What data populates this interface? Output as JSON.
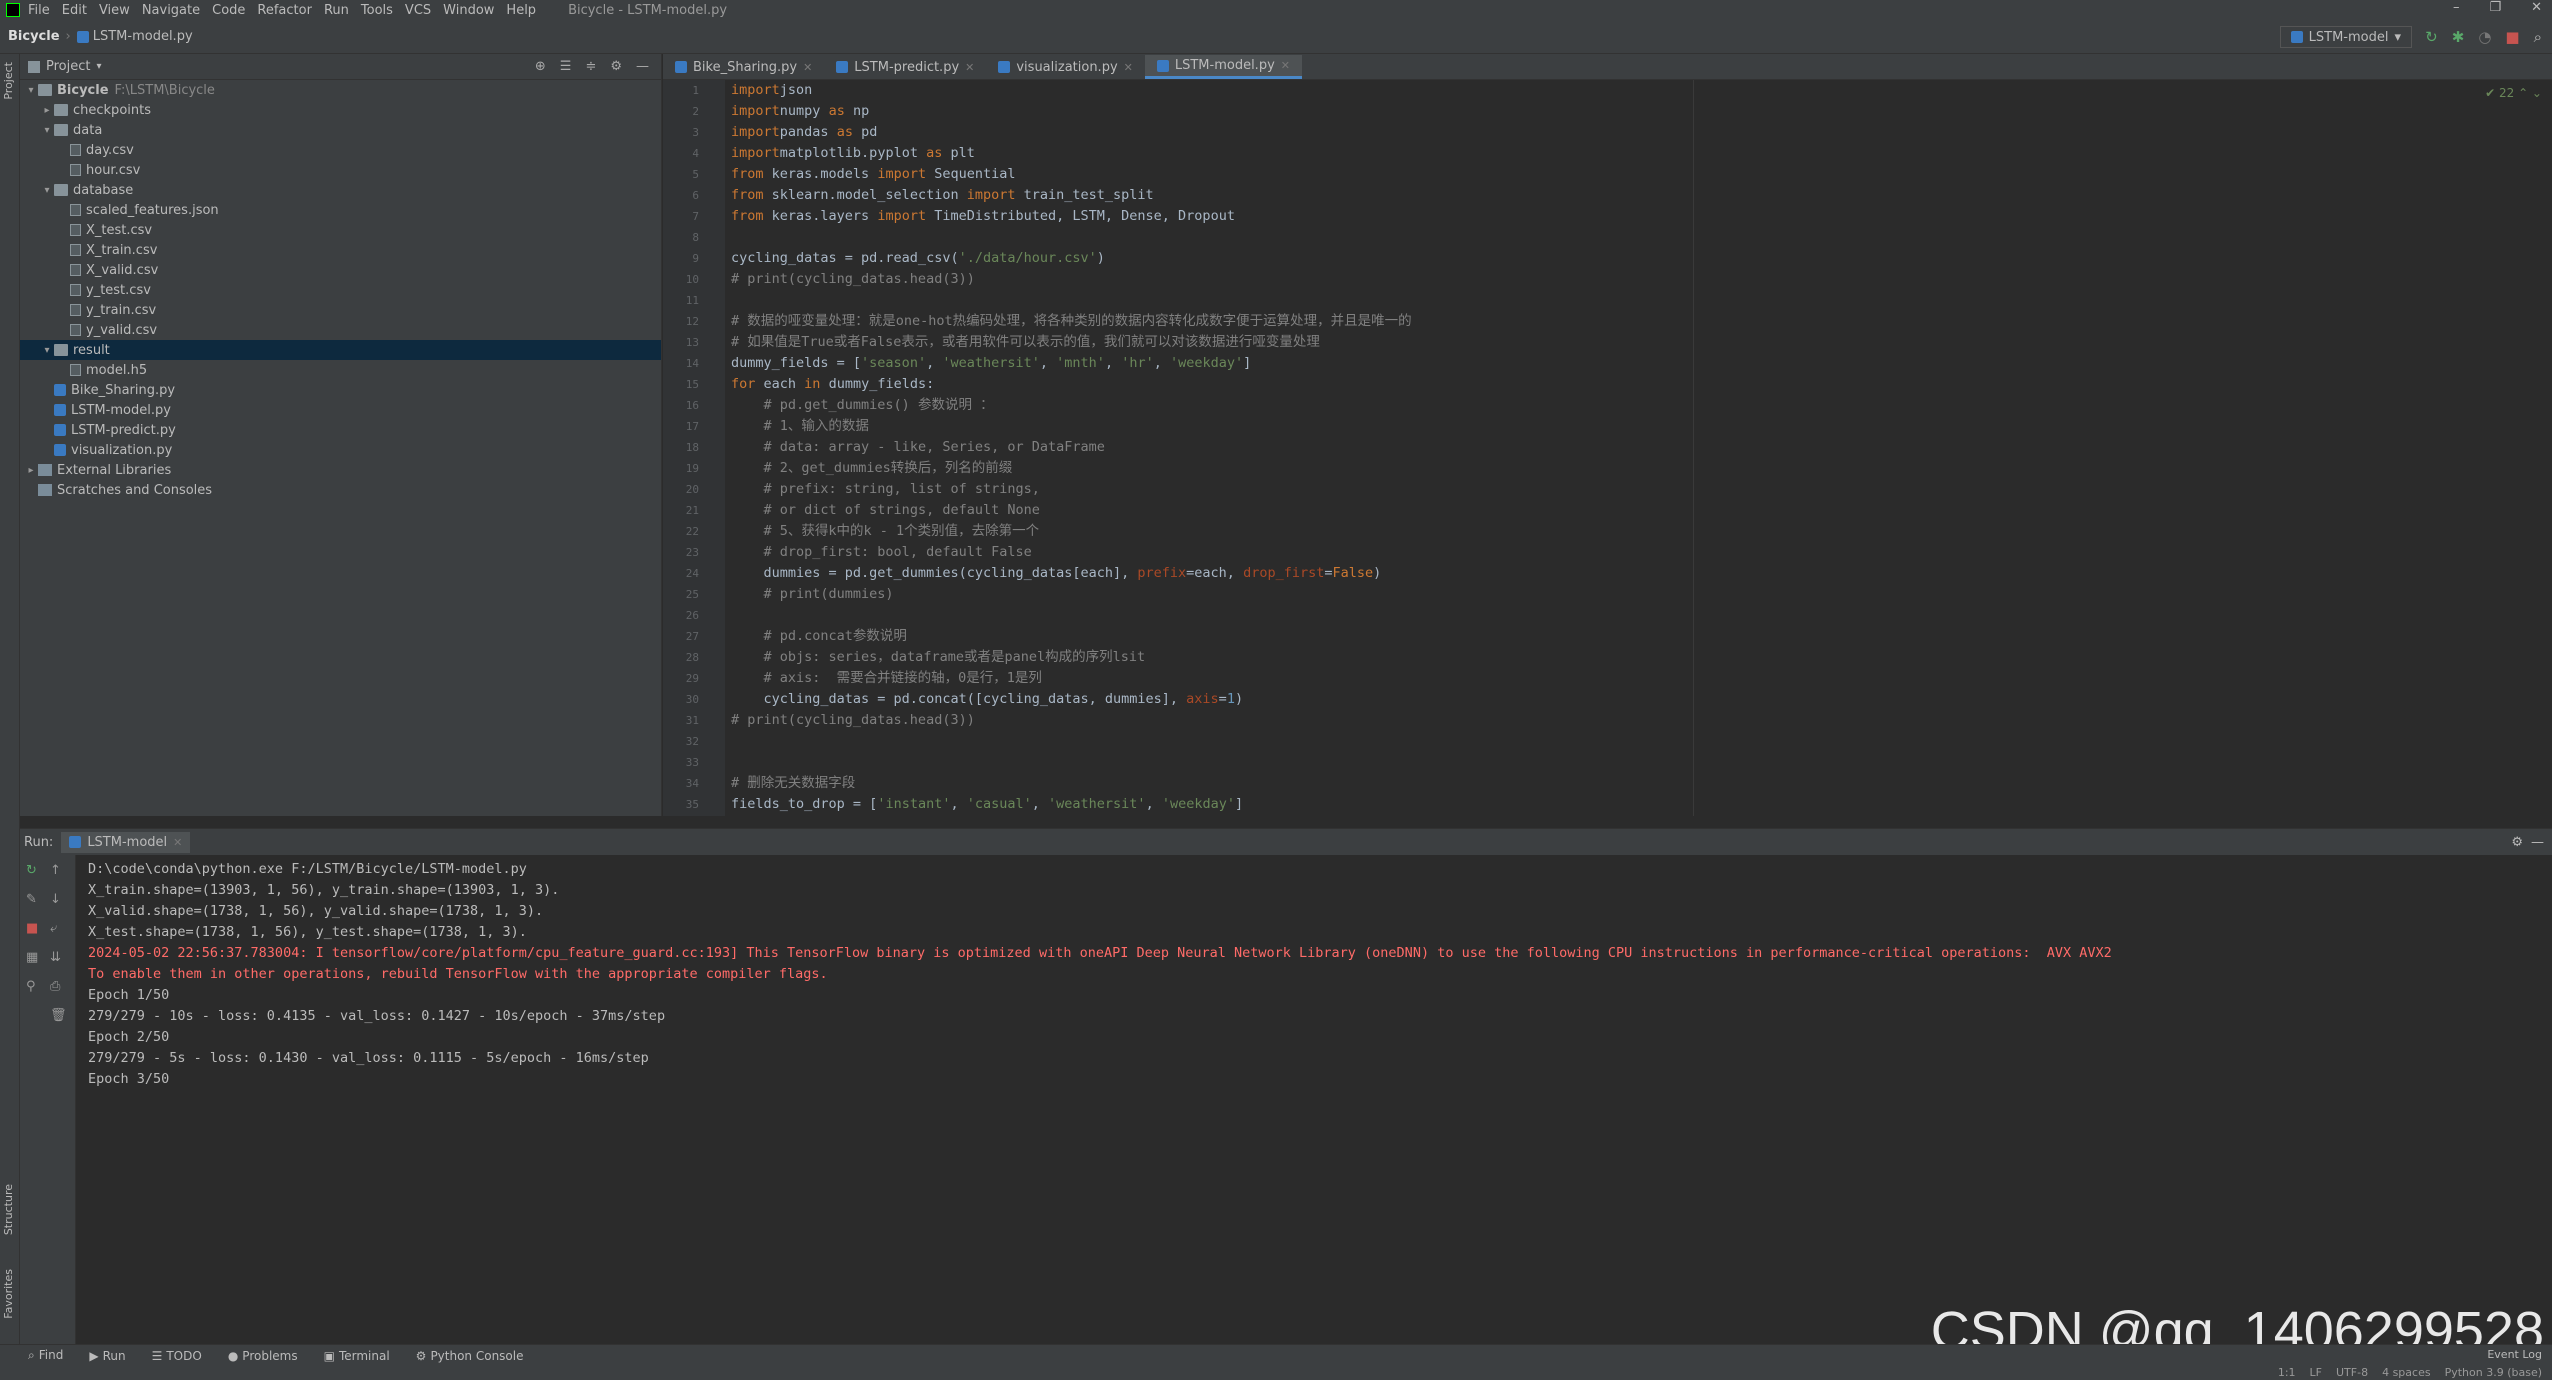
{
  "menubar": {
    "items": [
      "File",
      "Edit",
      "View",
      "Navigate",
      "Code",
      "Refactor",
      "Run",
      "Tools",
      "VCS",
      "Window",
      "Help"
    ],
    "window_title": "Bicycle - LSTM-model.py"
  },
  "navbar": {
    "project": "Bicycle",
    "file": "LSTM-model.py",
    "run_config": "LSTM-model"
  },
  "project_panel": {
    "title": "Project",
    "tree": [
      {
        "label": "Bicycle",
        "path": "F:\\LSTM\\Bicycle",
        "level": 0,
        "type": "folder",
        "open": true
      },
      {
        "label": "checkpoints",
        "level": 1,
        "type": "folder",
        "open": false
      },
      {
        "label": "data",
        "level": 1,
        "type": "folder",
        "open": true
      },
      {
        "label": "day.csv",
        "level": 2,
        "type": "file"
      },
      {
        "label": "hour.csv",
        "level": 2,
        "type": "file"
      },
      {
        "label": "database",
        "level": 1,
        "type": "folder",
        "open": true
      },
      {
        "label": "scaled_features.json",
        "level": 2,
        "type": "file"
      },
      {
        "label": "X_test.csv",
        "level": 2,
        "type": "file"
      },
      {
        "label": "X_train.csv",
        "level": 2,
        "type": "file"
      },
      {
        "label": "X_valid.csv",
        "level": 2,
        "type": "file"
      },
      {
        "label": "y_test.csv",
        "level": 2,
        "type": "file"
      },
      {
        "label": "y_train.csv",
        "level": 2,
        "type": "file"
      },
      {
        "label": "y_valid.csv",
        "level": 2,
        "type": "file"
      },
      {
        "label": "result",
        "level": 1,
        "type": "folder",
        "open": true,
        "selected": true
      },
      {
        "label": "model.h5",
        "level": 2,
        "type": "file"
      },
      {
        "label": "Bike_Sharing.py",
        "level": 1,
        "type": "py"
      },
      {
        "label": "LSTM-model.py",
        "level": 1,
        "type": "py"
      },
      {
        "label": "LSTM-predict.py",
        "level": 1,
        "type": "py"
      },
      {
        "label": "visualization.py",
        "level": 1,
        "type": "py"
      },
      {
        "label": "External Libraries",
        "level": 0,
        "type": "lib",
        "open": false
      },
      {
        "label": "Scratches and Consoles",
        "level": 0,
        "type": "lib"
      }
    ]
  },
  "editor": {
    "tabs": [
      "Bike_Sharing.py",
      "LSTM-predict.py",
      "visualization.py",
      "LSTM-model.py"
    ],
    "active_tab": 3,
    "inspection_count": "22",
    "line_numbers": [
      "1",
      "2",
      "3",
      "4",
      "5",
      "6",
      "7",
      "8",
      "9",
      "10",
      "11",
      "12",
      "13",
      "14",
      "15",
      "16",
      "17",
      "18",
      "19",
      "20",
      "21",
      "22",
      "23",
      "24",
      "25",
      "26",
      "27",
      "28",
      "29",
      "30",
      "31",
      "32",
      "33",
      "34",
      "35"
    ],
    "lines": [
      [
        [
          "kw",
          "import"
        ],
        [
          "",
          "json"
        ]
      ],
      [
        [
          "kw",
          "import"
        ],
        [
          "",
          "numpy "
        ],
        [
          "kw",
          "as"
        ],
        [
          "",
          " np"
        ]
      ],
      [
        [
          "kw",
          "import"
        ],
        [
          "",
          "pandas "
        ],
        [
          "kw",
          "as"
        ],
        [
          "",
          " pd"
        ]
      ],
      [
        [
          "kw",
          "import"
        ],
        [
          "",
          "matplotlib.pyplot "
        ],
        [
          "kw",
          "as"
        ],
        [
          "",
          " plt"
        ]
      ],
      [
        [
          "kw",
          "from"
        ],
        [
          "",
          " keras.models "
        ],
        [
          "kw",
          "import"
        ],
        [
          "",
          " Sequential"
        ]
      ],
      [
        [
          "kw",
          "from"
        ],
        [
          "",
          " sklearn.model_selection "
        ],
        [
          "kw",
          "import"
        ],
        [
          "",
          " train_test_split"
        ]
      ],
      [
        [
          "kw",
          "from"
        ],
        [
          "",
          " keras.layers "
        ],
        [
          "kw",
          "import"
        ],
        [
          "",
          " TimeDistributed, LSTM, Dense, Dropout"
        ]
      ],
      [],
      [
        [
          "",
          "cycling_datas = pd.read_csv("
        ],
        [
          "str",
          "'./data/hour.csv'"
        ],
        [
          "",
          ")"
        ]
      ],
      [
        [
          "com",
          "# print(cycling_datas.head(3))"
        ]
      ],
      [],
      [
        [
          "com",
          "# 数据的哑变量处理：就是one-hot热编码处理，将各种类别的数据内容转化成数字便于运算处理，并且是唯一的"
        ]
      ],
      [
        [
          "com",
          "# 如果值是True或者False表示，或者用软件可以表示的值，我们就可以对该数据进行哑变量处理"
        ]
      ],
      [
        [
          "",
          "dummy_fields = ["
        ],
        [
          "str",
          "'season'"
        ],
        [
          "",
          ", "
        ],
        [
          "str",
          "'weathersit'"
        ],
        [
          "",
          ", "
        ],
        [
          "str",
          "'mnth'"
        ],
        [
          "",
          ", "
        ],
        [
          "str",
          "'hr'"
        ],
        [
          "",
          ", "
        ],
        [
          "str",
          "'weekday'"
        ],
        [
          "",
          "]"
        ]
      ],
      [
        [
          "kw",
          "for"
        ],
        [
          "",
          " each "
        ],
        [
          "kw",
          "in"
        ],
        [
          "",
          " dummy_fields:"
        ]
      ],
      [
        [
          "",
          "    "
        ],
        [
          "com",
          "# pd.get_dummies() 参数说明 ："
        ]
      ],
      [
        [
          "",
          "    "
        ],
        [
          "com",
          "# 1、输入的数据"
        ]
      ],
      [
        [
          "",
          "    "
        ],
        [
          "com",
          "# data: array - like, Series, or DataFrame"
        ]
      ],
      [
        [
          "",
          "    "
        ],
        [
          "com",
          "# 2、get_dummies转换后，列名的前缀"
        ]
      ],
      [
        [
          "",
          "    "
        ],
        [
          "com",
          "# prefix: string, list of strings,"
        ]
      ],
      [
        [
          "",
          "    "
        ],
        [
          "com",
          "# or dict of strings, default None"
        ]
      ],
      [
        [
          "",
          "    "
        ],
        [
          "com",
          "# 5、获得k中的k - 1个类别值，去除第一个"
        ]
      ],
      [
        [
          "",
          "    "
        ],
        [
          "com",
          "# drop_first: bool, default False"
        ]
      ],
      [
        [
          "",
          "    dummies = pd.get_dummies(cycling_datas[each], "
        ],
        [
          "prm",
          "prefix"
        ],
        [
          "",
          "=each, "
        ],
        [
          "prm",
          "drop_first"
        ],
        [
          "",
          "="
        ],
        [
          "kw",
          "False"
        ],
        [
          "",
          ")"
        ]
      ],
      [
        [
          "",
          "    "
        ],
        [
          "com",
          "# print(dummies)"
        ]
      ],
      [],
      [
        [
          "",
          "    "
        ],
        [
          "com",
          "# pd.concat参数说明"
        ]
      ],
      [
        [
          "",
          "    "
        ],
        [
          "com",
          "# objs: series，dataframe或者是panel构成的序列lsit"
        ]
      ],
      [
        [
          "",
          "    "
        ],
        [
          "com",
          "# axis:  需要合并链接的轴，0是行，1是列"
        ]
      ],
      [
        [
          "",
          "    cycling_datas = pd.concat([cycling_datas, dummies], "
        ],
        [
          "prm",
          "axis"
        ],
        [
          "",
          "="
        ],
        [
          "num",
          "1"
        ],
        [
          "",
          ")"
        ]
      ],
      [
        [
          "com",
          "# print(cycling_datas.head(3))"
        ]
      ],
      [],
      [],
      [
        [
          "com",
          "# 删除无关数据字段"
        ]
      ],
      [
        [
          "",
          "fields_to_drop = ["
        ],
        [
          "str",
          "'instant'"
        ],
        [
          "",
          ", "
        ],
        [
          "str",
          "'casual'"
        ],
        [
          "",
          ", "
        ],
        [
          "str",
          "'weathersit'"
        ],
        [
          "",
          ", "
        ],
        [
          "str",
          "'weekday'"
        ],
        [
          "",
          "]"
        ]
      ]
    ]
  },
  "run_panel": {
    "label": "Run:",
    "tab": "LSTM-model",
    "output": [
      {
        "t": "D:\\code\\conda\\python.exe F:/LSTM/Bicycle/LSTM-model.py",
        "e": false
      },
      {
        "t": "X_train.shape=(13903, 1, 56), y_train.shape=(13903, 1, 3).",
        "e": false
      },
      {
        "t": "X_valid.shape=(1738, 1, 56), y_valid.shape=(1738, 1, 3).",
        "e": false
      },
      {
        "t": "X_test.shape=(1738, 1, 56), y_test.shape=(1738, 1, 3).",
        "e": false
      },
      {
        "t": "2024-05-02 22:56:37.783004: I tensorflow/core/platform/cpu_feature_guard.cc:193] This TensorFlow binary is optimized with oneAPI Deep Neural Network Library (oneDNN) to use the following CPU instructions in performance-critical operations:  AVX AVX2",
        "e": true
      },
      {
        "t": "To enable them in other operations, rebuild TensorFlow with the appropriate compiler flags.",
        "e": true
      },
      {
        "t": "Epoch 1/50",
        "e": false
      },
      {
        "t": "279/279 - 10s - loss: 0.4135 - val_loss: 0.1427 - 10s/epoch - 37ms/step",
        "e": false
      },
      {
        "t": "Epoch 2/50",
        "e": false
      },
      {
        "t": "279/279 - 5s - loss: 0.1430 - val_loss: 0.1115 - 5s/epoch - 16ms/step",
        "e": false
      },
      {
        "t": "Epoch 3/50",
        "e": false
      }
    ]
  },
  "bottom_tabs": [
    "Find",
    "Run",
    "TODO",
    "Problems",
    "Terminal",
    "Python Console"
  ],
  "side_labels": {
    "project": "Project",
    "structure": "Structure",
    "favorites": "Favorites"
  },
  "status": {
    "position": "1:1",
    "line_sep": "LF",
    "encoding": "UTF-8",
    "indent": "4 spaces",
    "interpreter": "Python 3.9 (base)",
    "event_log": "Event Log"
  },
  "watermark": "CSDN @qq_1406299528"
}
